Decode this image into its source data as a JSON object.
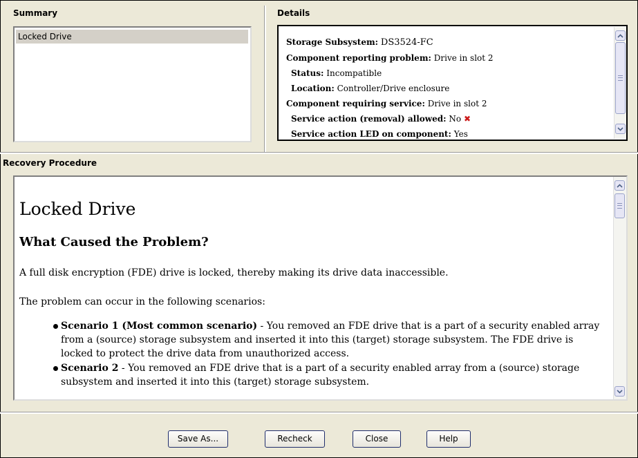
{
  "summary": {
    "title": "Summary",
    "items": [
      {
        "label": "Locked Drive"
      }
    ]
  },
  "details": {
    "title": "Details",
    "lines": [
      {
        "label": "Storage Subsystem:",
        "value": "DS3524-FC"
      },
      {
        "label": "Component reporting problem:",
        "value": "Drive in slot 2"
      },
      {
        "label": "Status:",
        "value": "Incompatible"
      },
      {
        "label": "Location:",
        "value": "Controller/Drive enclosure"
      },
      {
        "label": "Component requiring service:",
        "value": "Drive in slot 2"
      },
      {
        "label": "Service action (removal) allowed:",
        "value": "No"
      },
      {
        "label": "Service action LED on component:",
        "value": "Yes"
      }
    ]
  },
  "recovery": {
    "title": "Recovery Procedure",
    "doc_title": "Locked Drive",
    "heading": "What Caused the Problem?",
    "paragraph1": "A full disk encryption (FDE) drive is locked, thereby making its drive data inaccessible.",
    "paragraph2": "The problem can occur in the following scenarios:",
    "scenarios": [
      {
        "bold": "Scenario 1 (Most common scenario)",
        "text": " - You removed an FDE drive that is a part of a security enabled array from a (source) storage subsystem and inserted it into this (target) storage subsystem. The FDE drive is locked to protect the drive data from unauthorized access."
      },
      {
        "bold": "Scenario 2",
        "text": " - You removed an FDE drive that is a part of a security enabled array from a (source) storage subsystem and inserted it into this (target) storage subsystem."
      }
    ]
  },
  "buttons": {
    "save_as": "Save As...",
    "recheck": "Recheck",
    "close": "Close",
    "help": "Help"
  },
  "colors": {
    "background": "#ece9d8",
    "error_icon": "#cc1a1a",
    "button_border": "#1e2c6b"
  }
}
